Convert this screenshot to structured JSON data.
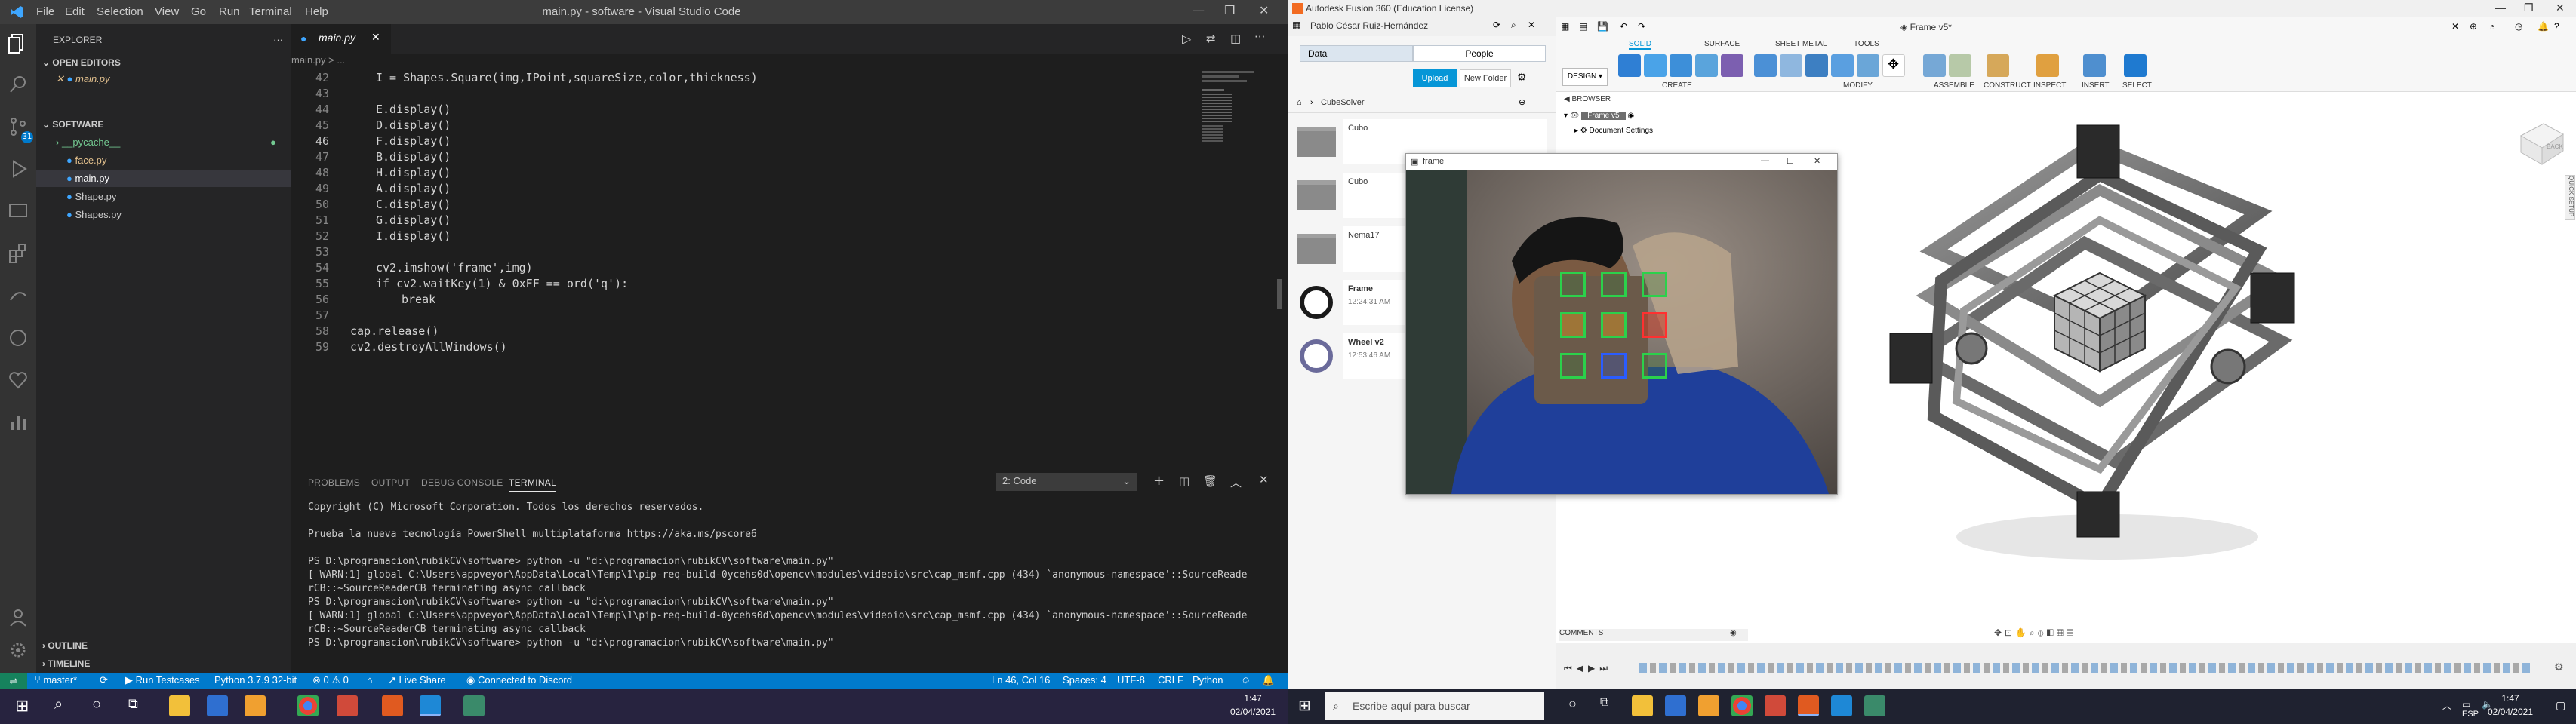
{
  "vscode": {
    "window_title": "main.py - software - Visual Studio Code",
    "menu": [
      "File",
      "Edit",
      "Selection",
      "View",
      "Go",
      "Run",
      "Terminal",
      "Help"
    ],
    "explorer_title": "EXPLORER",
    "open_editors": "OPEN EDITORS",
    "open_file": "main.py",
    "folder": "SOFTWARE",
    "files": [
      "__pycache__",
      "face.py",
      "main.py",
      "Shape.py",
      "Shapes.py"
    ],
    "outline": "OUTLINE",
    "timeline": "TIMELINE",
    "tab_label": "main.py",
    "breadcrumb": "main.py > ...",
    "code_lines": [
      {
        "n": "42",
        "t": "I = Shapes.Square(img,IPoint,squareSize,color,thickness)"
      },
      {
        "n": "43",
        "t": ""
      },
      {
        "n": "44",
        "t": "E.display()"
      },
      {
        "n": "45",
        "t": "D.display()"
      },
      {
        "n": "46",
        "t": "F.display()"
      },
      {
        "n": "47",
        "t": "B.display()"
      },
      {
        "n": "48",
        "t": "H.display()"
      },
      {
        "n": "49",
        "t": "A.display()"
      },
      {
        "n": "50",
        "t": "C.display()"
      },
      {
        "n": "51",
        "t": "G.display()"
      },
      {
        "n": "52",
        "t": "I.display()"
      },
      {
        "n": "53",
        "t": ""
      },
      {
        "n": "54",
        "t": "cv2.imshow('frame',img)"
      },
      {
        "n": "55",
        "t": "if cv2.waitKey(1) & 0xFF == ord('q'):"
      },
      {
        "n": "56",
        "t": "break"
      },
      {
        "n": "57",
        "t": ""
      },
      {
        "n": "58",
        "t": "cap.release()"
      },
      {
        "n": "59",
        "t": "cv2.destroyAllWindows()"
      }
    ],
    "panel_tabs": [
      "PROBLEMS",
      "OUTPUT",
      "DEBUG CONSOLE",
      "TERMINAL"
    ],
    "terminal_select": "2: Code",
    "terminal_lines": [
      "Copyright (C) Microsoft Corporation. Todos los derechos reservados.",
      "",
      "Prueba la nueva tecnología PowerShell multiplataforma https://aka.ms/pscore6",
      "",
      "PS D:\\programacion\\rubikCV\\software> python -u \"d:\\programacion\\rubikCV\\software\\main.py\"",
      "[ WARN:1] global C:\\Users\\appveyor\\AppData\\Local\\Temp\\1\\pip-req-build-0ycehs0d\\opencv\\modules\\videoio\\src\\cap_msmf.cpp (434) `anonymous-namespace'::SourceReade",
      "rCB::~SourceReaderCB terminating async callback",
      "PS D:\\programacion\\rubikCV\\software> python -u \"d:\\programacion\\rubikCV\\software\\main.py\"",
      "[ WARN:1] global C:\\Users\\appveyor\\AppData\\Local\\Temp\\1\\pip-req-build-0ycehs0d\\opencv\\modules\\videoio\\src\\cap_msmf.cpp (434) `anonymous-namespace'::SourceReade",
      "rCB::~SourceReaderCB terminating async callback",
      "PS D:\\programacion\\rubikCV\\software> python -u \"d:\\programacion\\rubikCV\\software\\main.py\""
    ],
    "status": {
      "branch": "master*",
      "run_testcases": "Run Testcases",
      "python": "Python 3.7.9 32-bit",
      "problems": "⊗ 0 ⚠ 0",
      "live_share": "Live Share",
      "discord": "Connected to Discord",
      "position": "Ln 46, Col 16",
      "spaces": "Spaces: 4",
      "encoding": "UTF-8",
      "eol": "CRLF",
      "language": "Python"
    },
    "badge_count": "1"
  },
  "fusion": {
    "window_title": "Autodesk Fusion 360 (Education License)",
    "user": "Pablo César Ruiz-Hernández",
    "doc_tab": "Frame v5*",
    "data_tab": "Data",
    "people_tab": "People",
    "upload": "Upload",
    "new_folder": "New Folder",
    "project": "CubeSolver",
    "folders": [
      {
        "name": "Cubo"
      },
      {
        "name": "Cubo"
      },
      {
        "name": "Nema17"
      }
    ],
    "files": [
      {
        "name": "Frame",
        "time": "12:24:31 AM"
      },
      {
        "name": "Wheel v2",
        "time": "12:53:46 AM"
      }
    ],
    "design_menu": "DESIGN",
    "toolbar_tabs": [
      "SOLID",
      "SURFACE",
      "SHEET METAL",
      "TOOLS"
    ],
    "toolbar_groups": [
      "CREATE",
      "MODIFY",
      "ASSEMBLE",
      "CONSTRUCT",
      "INSPECT",
      "INSERT",
      "SELECT"
    ],
    "browser_label": "BROWSER",
    "browser_items": [
      "Frame v5",
      "Document Settings"
    ],
    "comments": "COMMENTS",
    "viewcube": "BACK",
    "frame_window_title": "frame"
  },
  "taskbar": {
    "search_placeholder": "Escribe aquí para buscar",
    "time_left": "1:47",
    "date_left": "02/04/2021",
    "time_right": "1:47",
    "date_right": "02/04/2021",
    "lang": "ESP"
  },
  "colors": {
    "vscode_status": "#007acc",
    "vscode_bg": "#1e1e1e",
    "fusion_accent": "#0696d7",
    "taskbar": "#1f2a4d"
  }
}
